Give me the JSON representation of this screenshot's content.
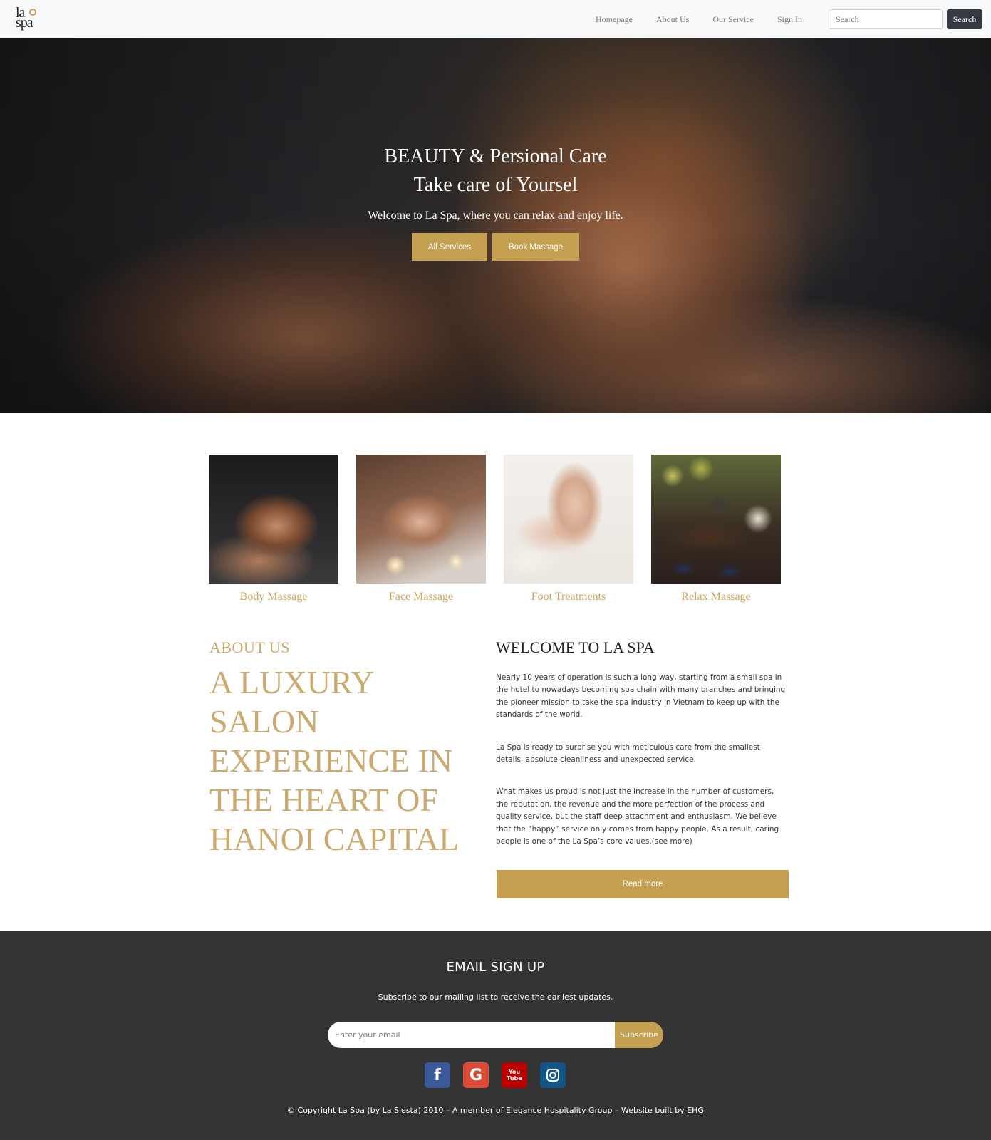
{
  "brand": {
    "logo_line1": "la",
    "logo_line2": "spa",
    "accent": "#c5a050"
  },
  "nav": {
    "links": [
      "Homepage",
      "About Us",
      "Our Service",
      "Sign In"
    ],
    "search_placeholder": "Search",
    "search_button": "Search"
  },
  "hero": {
    "title_line1": "BEAUTY & Persional Care",
    "title_line2": "Take care of Yoursel",
    "subtitle": "Welcome to La Spa, where you can relax and enjoy life.",
    "btn_all_services": "All Services",
    "btn_book_massage": "Book Massage"
  },
  "services": [
    {
      "label": "Body Massage"
    },
    {
      "label": "Face Massage"
    },
    {
      "label": "Foot Treatments"
    },
    {
      "label": "Relax Massage"
    }
  ],
  "about": {
    "eyebrow": "ABOUT US",
    "heading": "A LUXURY SALON EXPERIENCE IN THE HEART OF HANOI CAPITAL",
    "welcome_title": "WELCOME TO LA SPA",
    "paragraph1": "Nearly 10 years of operation is such a long way, starting from a small spa in the hotel to nowadays becoming spa chain with many branches and bringing the pioneer mission to take the spa industry in Vietnam to keep up with the standards of the world.",
    "paragraph2": "La Spa is ready to surprise you with meticulous care from the smallest details, absolute cleanliness and unexpected service.",
    "paragraph3": "What makes us proud is not just the increase in the number of customers, the reputation, the revenue and the more perfection of the process and quality service, but the staff deep attachment and enthusiasm. We believe that the “happy” service only comes from happy people. As a result, caring people is one of the La Spa’s core values.(see more)",
    "read_more": "Read more"
  },
  "footer": {
    "title": "EMAIL SIGN UP",
    "subtitle": "Subscribe to our mailing list to receive the earliest updates.",
    "email_placeholder": "Enter your email",
    "subscribe_button": "Subscribe",
    "socials": [
      {
        "icon": "facebook-icon",
        "glyph": "f",
        "color": "#3b5998"
      },
      {
        "icon": "google-icon",
        "glyph": "G",
        "color": "#dd4b39"
      },
      {
        "icon": "youtube-icon",
        "glyph": "You Tube",
        "color": "#bb0000"
      },
      {
        "icon": "instagram-icon",
        "glyph": "",
        "color": "#125688"
      }
    ],
    "copyright": "© Copyright La Spa (by La Siesta) 2010 – A member of Elegance Hospitality Group – Website built by EHG"
  }
}
